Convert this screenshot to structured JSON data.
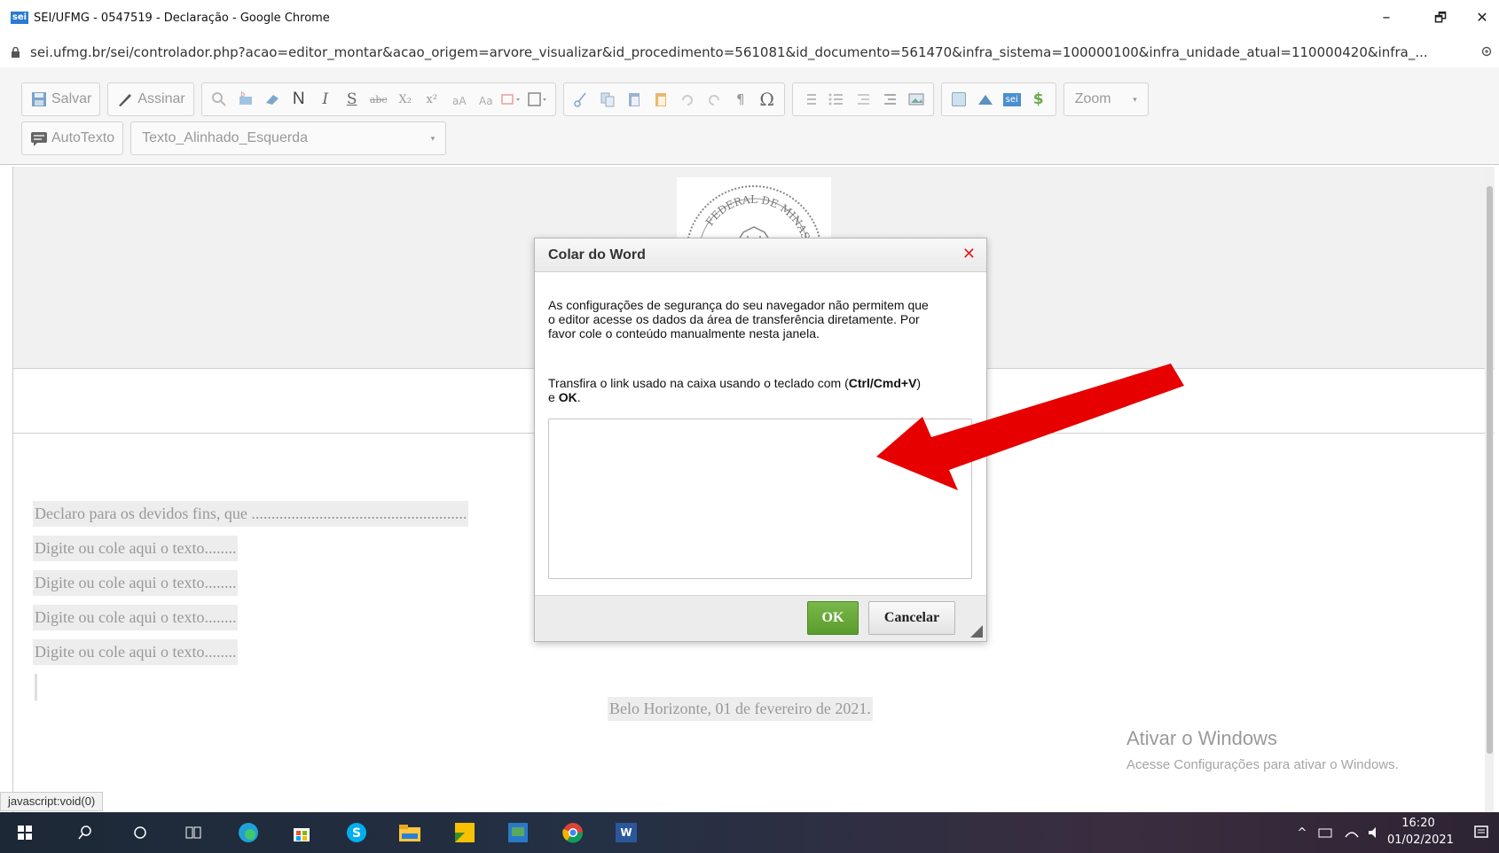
{
  "window": {
    "title": "SEI/UFMG - 0547519 - Declaração - Google Chrome",
    "favicon_text": "sei",
    "url": "sei.ufmg.br/sei/controlador.php?acao=editor_montar&acao_origem=arvore_visualizar&id_procedimento=561081&id_documento=561470&infra_sistema=100000100&infra_unidade_atual=110000420&infra_...",
    "minimize_glyph": "–",
    "restore_glyph": "🗗",
    "close_glyph": "✕"
  },
  "toolbar": {
    "save_label": "Salvar",
    "sign_label": "Assinar",
    "bold_glyph": "N",
    "italic_glyph": "I",
    "underline_glyph": "S",
    "strike_glyph": "abc",
    "subscript_glyph": "X₂",
    "superscript_glyph": "x²",
    "omega_glyph": "Ω",
    "pilcrow_glyph": "¶",
    "dollar_glyph": "$",
    "zoom_label": "Zoom",
    "autotext_label": "AutoTexto",
    "style_value": "Texto_Alinhado_Esquerda",
    "sei_badge": "sei"
  },
  "document": {
    "seal_text": "FEDERAL DE MINAS",
    "paragraph_1": "Declaro para os devidos fins, que ......................................................",
    "placeholder_lines": [
      "Digite ou cole aqui o texto........",
      "Digite ou cole aqui o texto........",
      "Digite ou cole aqui o texto........",
      "Digite ou cole aqui o texto........"
    ],
    "closing": "Belo Horizonte, 01 de fevereiro de 2021."
  },
  "watermark": {
    "title": "Ativar o Windows",
    "subtitle": "Acesse Configurações para ativar o Windows."
  },
  "status_tip": "javascript:void(0)",
  "dialog": {
    "title": "Colar do Word",
    "close_glyph": "✕",
    "message": "As configurações de segurança do seu navegador não permitem que o editor acesse os dados da área de transferência diretamente. Por favor cole o conteúdo manualmente nesta janela.",
    "instruction_prefix": "Transfira o link usado na caixa usando o teclado com (",
    "instruction_keys": "Ctrl/Cmd+V",
    "instruction_mid": ") e ",
    "instruction_ok": "OK",
    "instruction_end": ".",
    "ok_label": "OK",
    "cancel_label": "Cancelar"
  },
  "taskbar": {
    "time": "16:20",
    "date": "01/02/2021",
    "word_label": "W"
  },
  "colors": {
    "arrow": "#e60000",
    "ok_button": "#5a9c2d",
    "dialog_close": "#e02020"
  }
}
